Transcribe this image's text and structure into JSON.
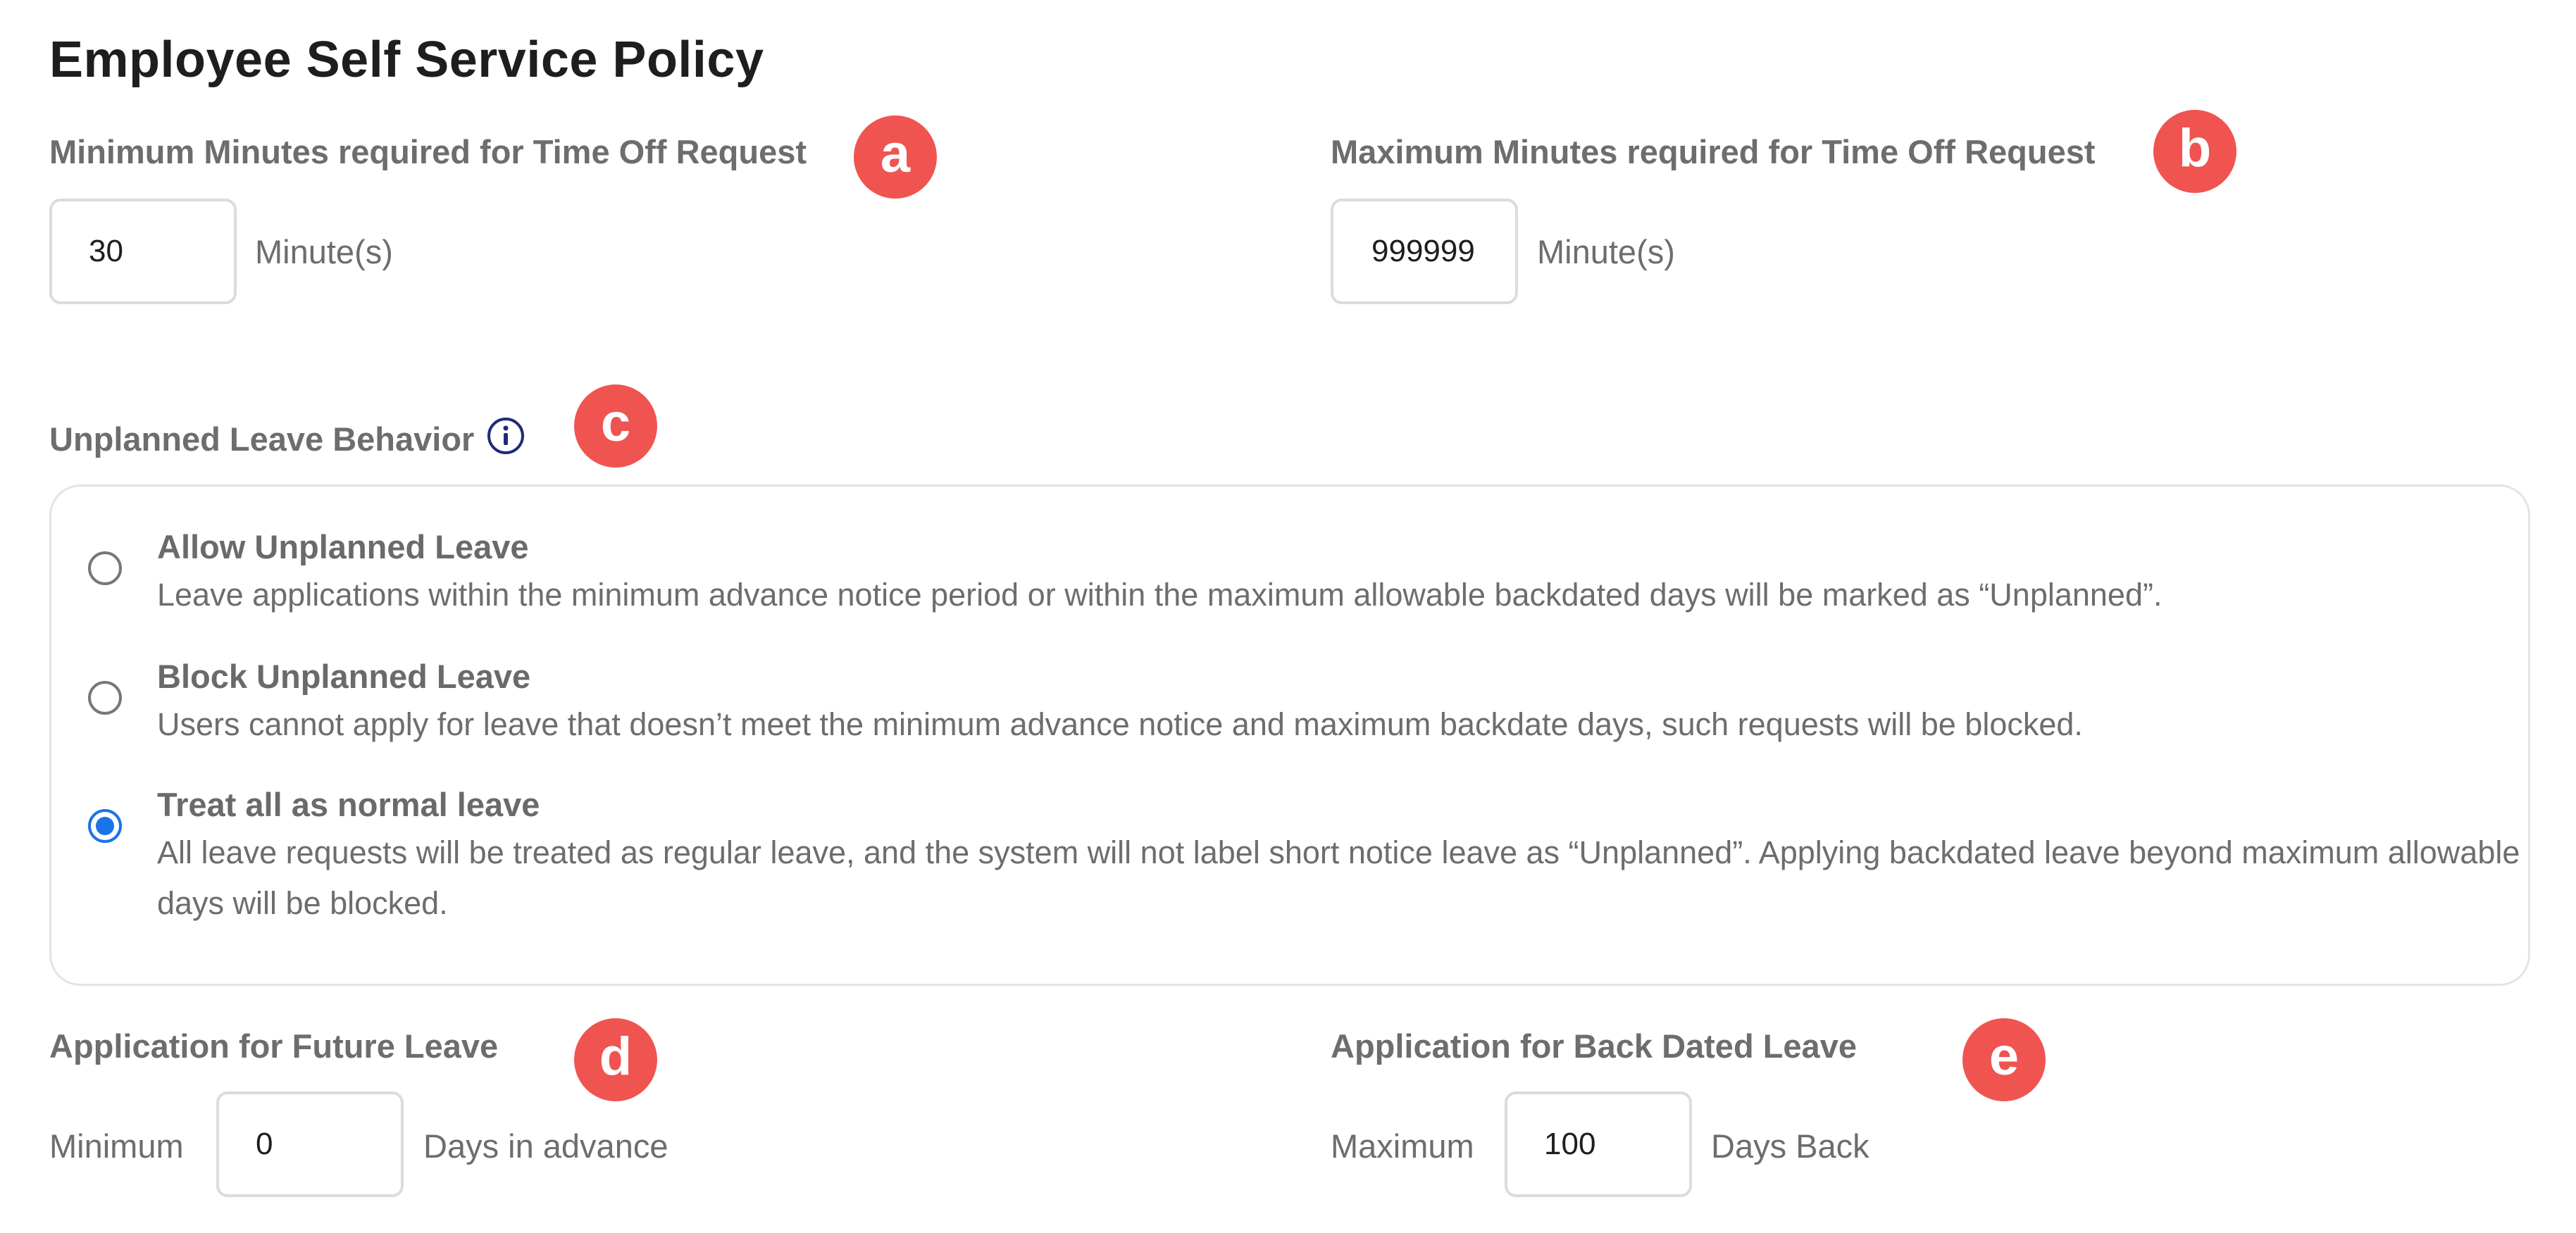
{
  "title": "Employee Self Service Policy",
  "min_minutes": {
    "label": "Minimum Minutes required for Time Off Request",
    "value": "30",
    "unit": "Minute(s)",
    "badge": "a"
  },
  "max_minutes": {
    "label": "Maximum Minutes required for Time Off Request",
    "value": "999999",
    "unit": "Minute(s)",
    "badge": "b"
  },
  "unplanned": {
    "label": "Unplanned Leave Behavior",
    "badge": "c",
    "selected": 2,
    "options": [
      {
        "title": "Allow Unplanned Leave",
        "description": "Leave applications within the minimum advance notice period or within the maximum allowable backdated days will be marked as “Unplanned”."
      },
      {
        "title": "Block Unplanned Leave",
        "description": "Users cannot apply for leave that doesn’t meet the minimum advance notice and maximum backdate days, such requests will be blocked."
      },
      {
        "title": "Treat all as normal leave",
        "description": "All leave requests will be treated as regular leave, and the system will not label short notice leave as “Unplanned”. Applying backdated leave beyond maximum allowable days will be blocked."
      }
    ]
  },
  "future_leave": {
    "label": "Application for Future Leave",
    "prefix": "Minimum",
    "value": "0",
    "suffix": "Days in advance",
    "badge": "d"
  },
  "back_dated_leave": {
    "label": "Application for Back Dated Leave",
    "prefix": "Maximum",
    "value": "100",
    "suffix": "Days Back",
    "badge": "e"
  },
  "colors": {
    "badge": "#ef5451",
    "radio_selected": "#1a73e8",
    "info_icon": "#1f2a7a"
  }
}
